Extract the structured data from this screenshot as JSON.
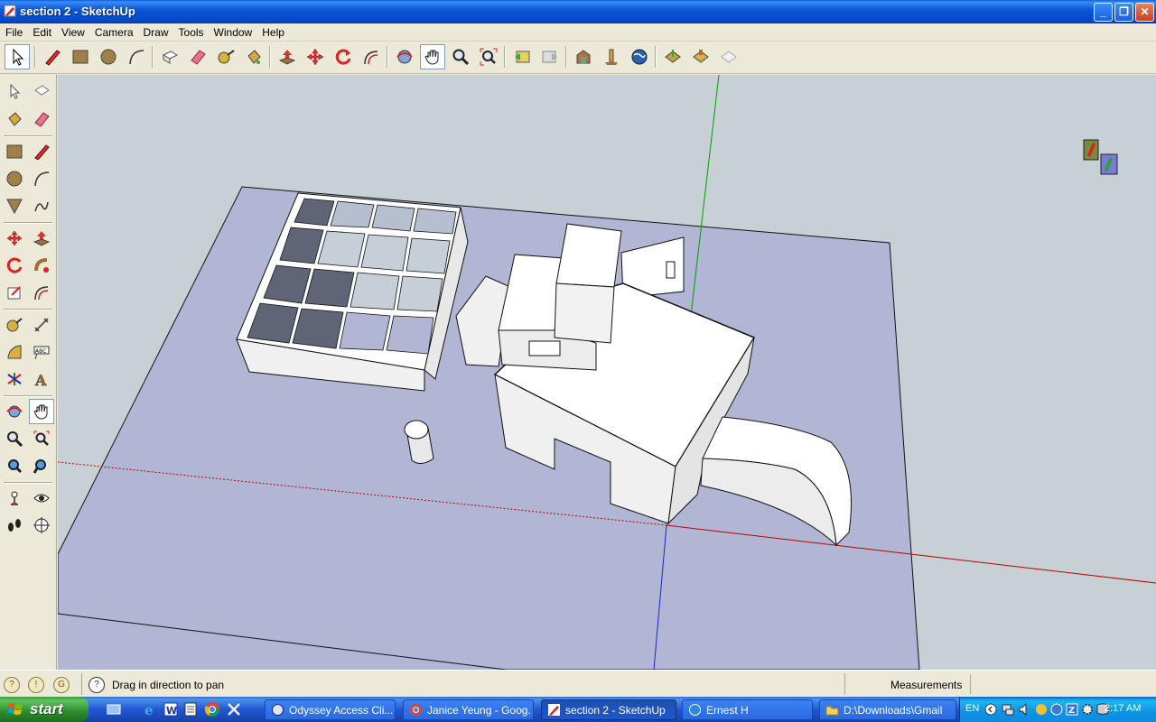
{
  "window": {
    "title": "section 2 - SketchUp"
  },
  "menu": {
    "items": [
      "File",
      "Edit",
      "View",
      "Camera",
      "Draw",
      "Tools",
      "Window",
      "Help"
    ]
  },
  "statusbar": {
    "hint": "Drag in direction to pan",
    "measurements_label": "Measurements",
    "measurements_value": ""
  },
  "taskbar": {
    "start_label": "start",
    "tasks": [
      {
        "label": "Odyssey Access Cli..."
      },
      {
        "label": "Janice Yeung - Goog..."
      },
      {
        "label": "section 2 - SketchUp"
      },
      {
        "label": "Ernest H"
      },
      {
        "label": "D:\\Downloads\\Gmail"
      }
    ],
    "language": "EN",
    "clock": "2:17 AM"
  },
  "colors": {
    "sky": "#c7d0d5",
    "ground": "#b0b6d4",
    "model_face": "#ffffff",
    "model_back": "#5f6577",
    "axis_red": "#c00000",
    "axis_green": "#00a000",
    "axis_blue": "#2020d0"
  },
  "active_tool": "pan-tool"
}
